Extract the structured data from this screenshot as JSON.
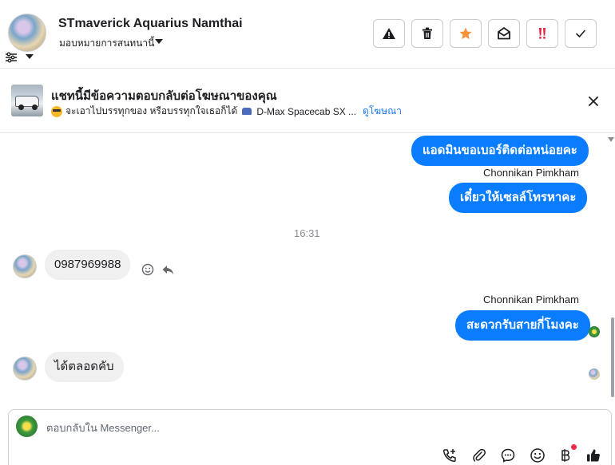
{
  "header": {
    "contact_name": "STmaverick Aquarius Namthai",
    "assign_label": "มอบหมายการสนทนานี้",
    "actions": [
      {
        "name": "spam",
        "icon": "warning-triangle-icon"
      },
      {
        "name": "delete",
        "icon": "trash-icon"
      },
      {
        "name": "star",
        "icon": "star-icon",
        "color": "#f7923b"
      },
      {
        "name": "mark-unread",
        "icon": "open-envelope-icon"
      },
      {
        "name": "follow-up",
        "icon": "double-exclamation-icon",
        "color": "#e41e3f"
      },
      {
        "name": "mark-done",
        "icon": "check-icon"
      }
    ]
  },
  "ad_banner": {
    "title": "แชทนี้มีข้อความตอบกลับต่อโฆษณาของคุณ",
    "desc_text": "จะเอาไปบรรทุกของ หรือบรรทุกใจเธอก็ได้",
    "desc_product": "D-Max Spacecab SX ...",
    "link_label": "ดูโฆษณา"
  },
  "messages": {
    "out_1": "แอดมินขอเบอร์ติดต่อหน่อยคะ",
    "sender_1": "Chonnikan Pimkham",
    "out_2": "เดี๋ยวให้เซลล์โทรหาคะ",
    "timestamp": "16:31",
    "in_1": "0987969988",
    "sender_2": "Chonnikan Pimkham",
    "out_3": "สะดวกรับสายกี่โมงคะ",
    "in_2": "ได้ตลอดคับ"
  },
  "composer": {
    "placeholder": "ตอบกลับใน Messenger...",
    "tools": [
      "call-request-icon",
      "attachment-icon",
      "saved-reply-icon",
      "emoji-icon",
      "baht-payment-icon",
      "like-icon"
    ]
  },
  "colors": {
    "outgoing_bubble": "#0a7cff",
    "incoming_bubble": "#f0f0f0",
    "link": "#1877f2"
  }
}
